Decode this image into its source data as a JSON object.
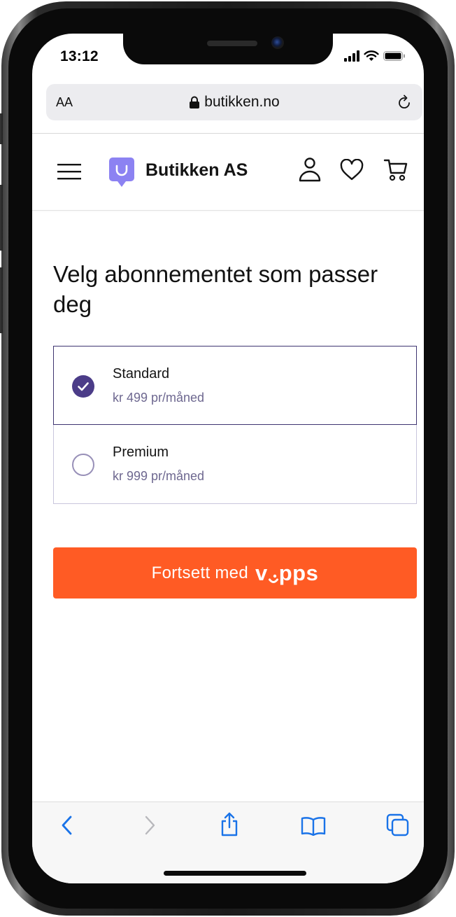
{
  "status_bar": {
    "time": "13:12"
  },
  "browser": {
    "text_size_label": "AA",
    "url": "butikken.no",
    "toolbar": {
      "icons": [
        "back-icon",
        "forward-icon",
        "share-icon",
        "bookmarks-icon",
        "tabs-icon"
      ]
    }
  },
  "header": {
    "brand": "Butikken AS",
    "icons": [
      "menu-icon",
      "shop-logo-icon",
      "user-icon",
      "heart-icon",
      "cart-icon"
    ]
  },
  "main": {
    "title": "Velg abonnementet som passer deg",
    "plans": [
      {
        "name": "Standard",
        "price": "kr 499 pr/måned",
        "selected": true
      },
      {
        "name": "Premium",
        "price": "kr 999 pr/måned",
        "selected": false
      }
    ],
    "cta": {
      "label": "Fortsett med",
      "brand": "vipps"
    }
  },
  "colors": {
    "accent": "#4b3c88",
    "vipps_orange": "#ff5b24",
    "logo_purple": "#8c82f2",
    "link_blue": "#1a73e8"
  }
}
